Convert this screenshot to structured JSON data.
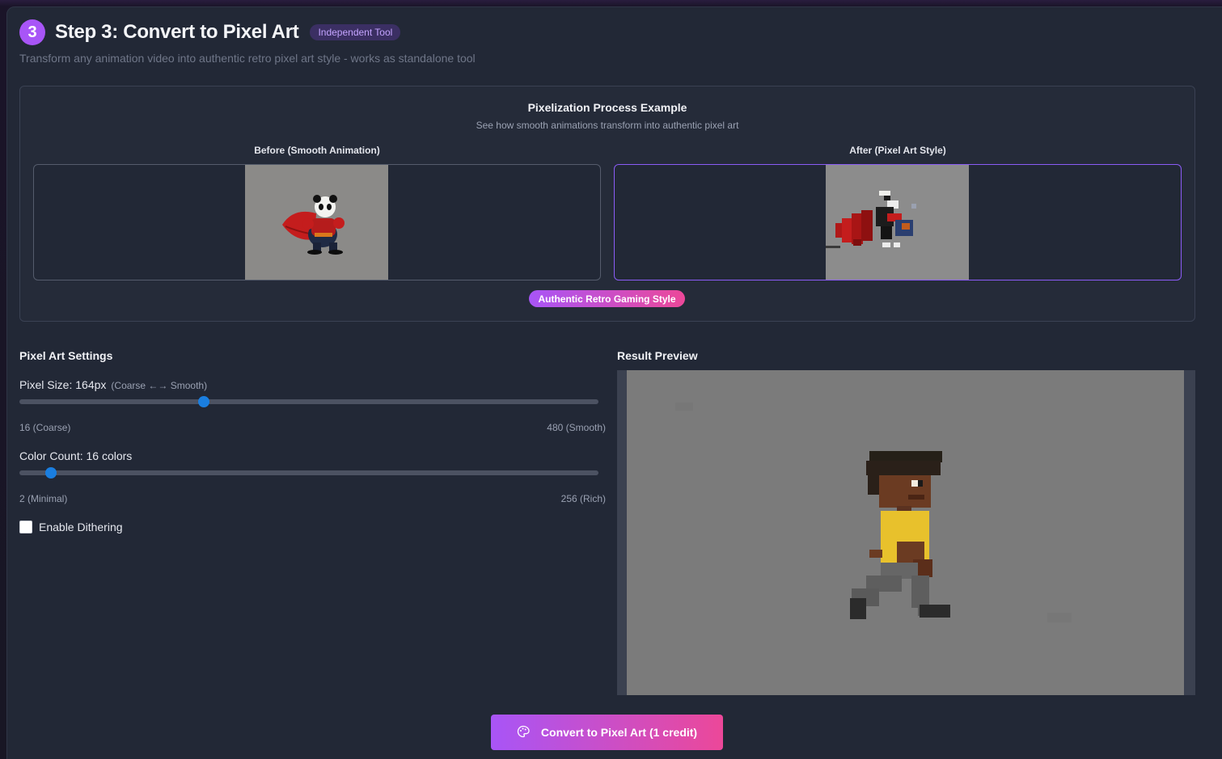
{
  "header": {
    "step_number": "3",
    "title": "Step 3: Convert to Pixel Art",
    "tag": "Independent Tool",
    "subtitle": "Transform any animation video into authentic retro pixel art style - works as standalone tool"
  },
  "example": {
    "title": "Pixelization Process Example",
    "subtitle": "See how smooth animations transform into authentic pixel art",
    "before_label": "Before (Smooth Animation)",
    "after_label": "After (Pixel Art Style)",
    "style_badge": "Authentic Retro Gaming Style"
  },
  "settings": {
    "title": "Pixel Art Settings",
    "pixel_size": {
      "label": "Pixel Size: 164px",
      "hint": "(Coarse ←→ Smooth)",
      "value": 164,
      "min": 16,
      "max": 480,
      "min_label": "16 (Coarse)",
      "max_label": "480 (Smooth)"
    },
    "color_count": {
      "label": "Color Count: 16 colors",
      "value": 16,
      "min": 2,
      "max": 256,
      "min_label": "2 (Minimal)",
      "max_label": "256 (Rich)"
    },
    "dithering": {
      "label": "Enable Dithering",
      "checked": false
    }
  },
  "preview": {
    "title": "Result Preview"
  },
  "actions": {
    "convert_label": "Convert to Pixel Art (1 credit)",
    "convert_icon": "palette-icon"
  },
  "colors": {
    "accent_purple": "#a855f7",
    "accent_pink": "#ec4899",
    "slider_blue": "#1a7ee0",
    "panel_bg": "#222836"
  }
}
